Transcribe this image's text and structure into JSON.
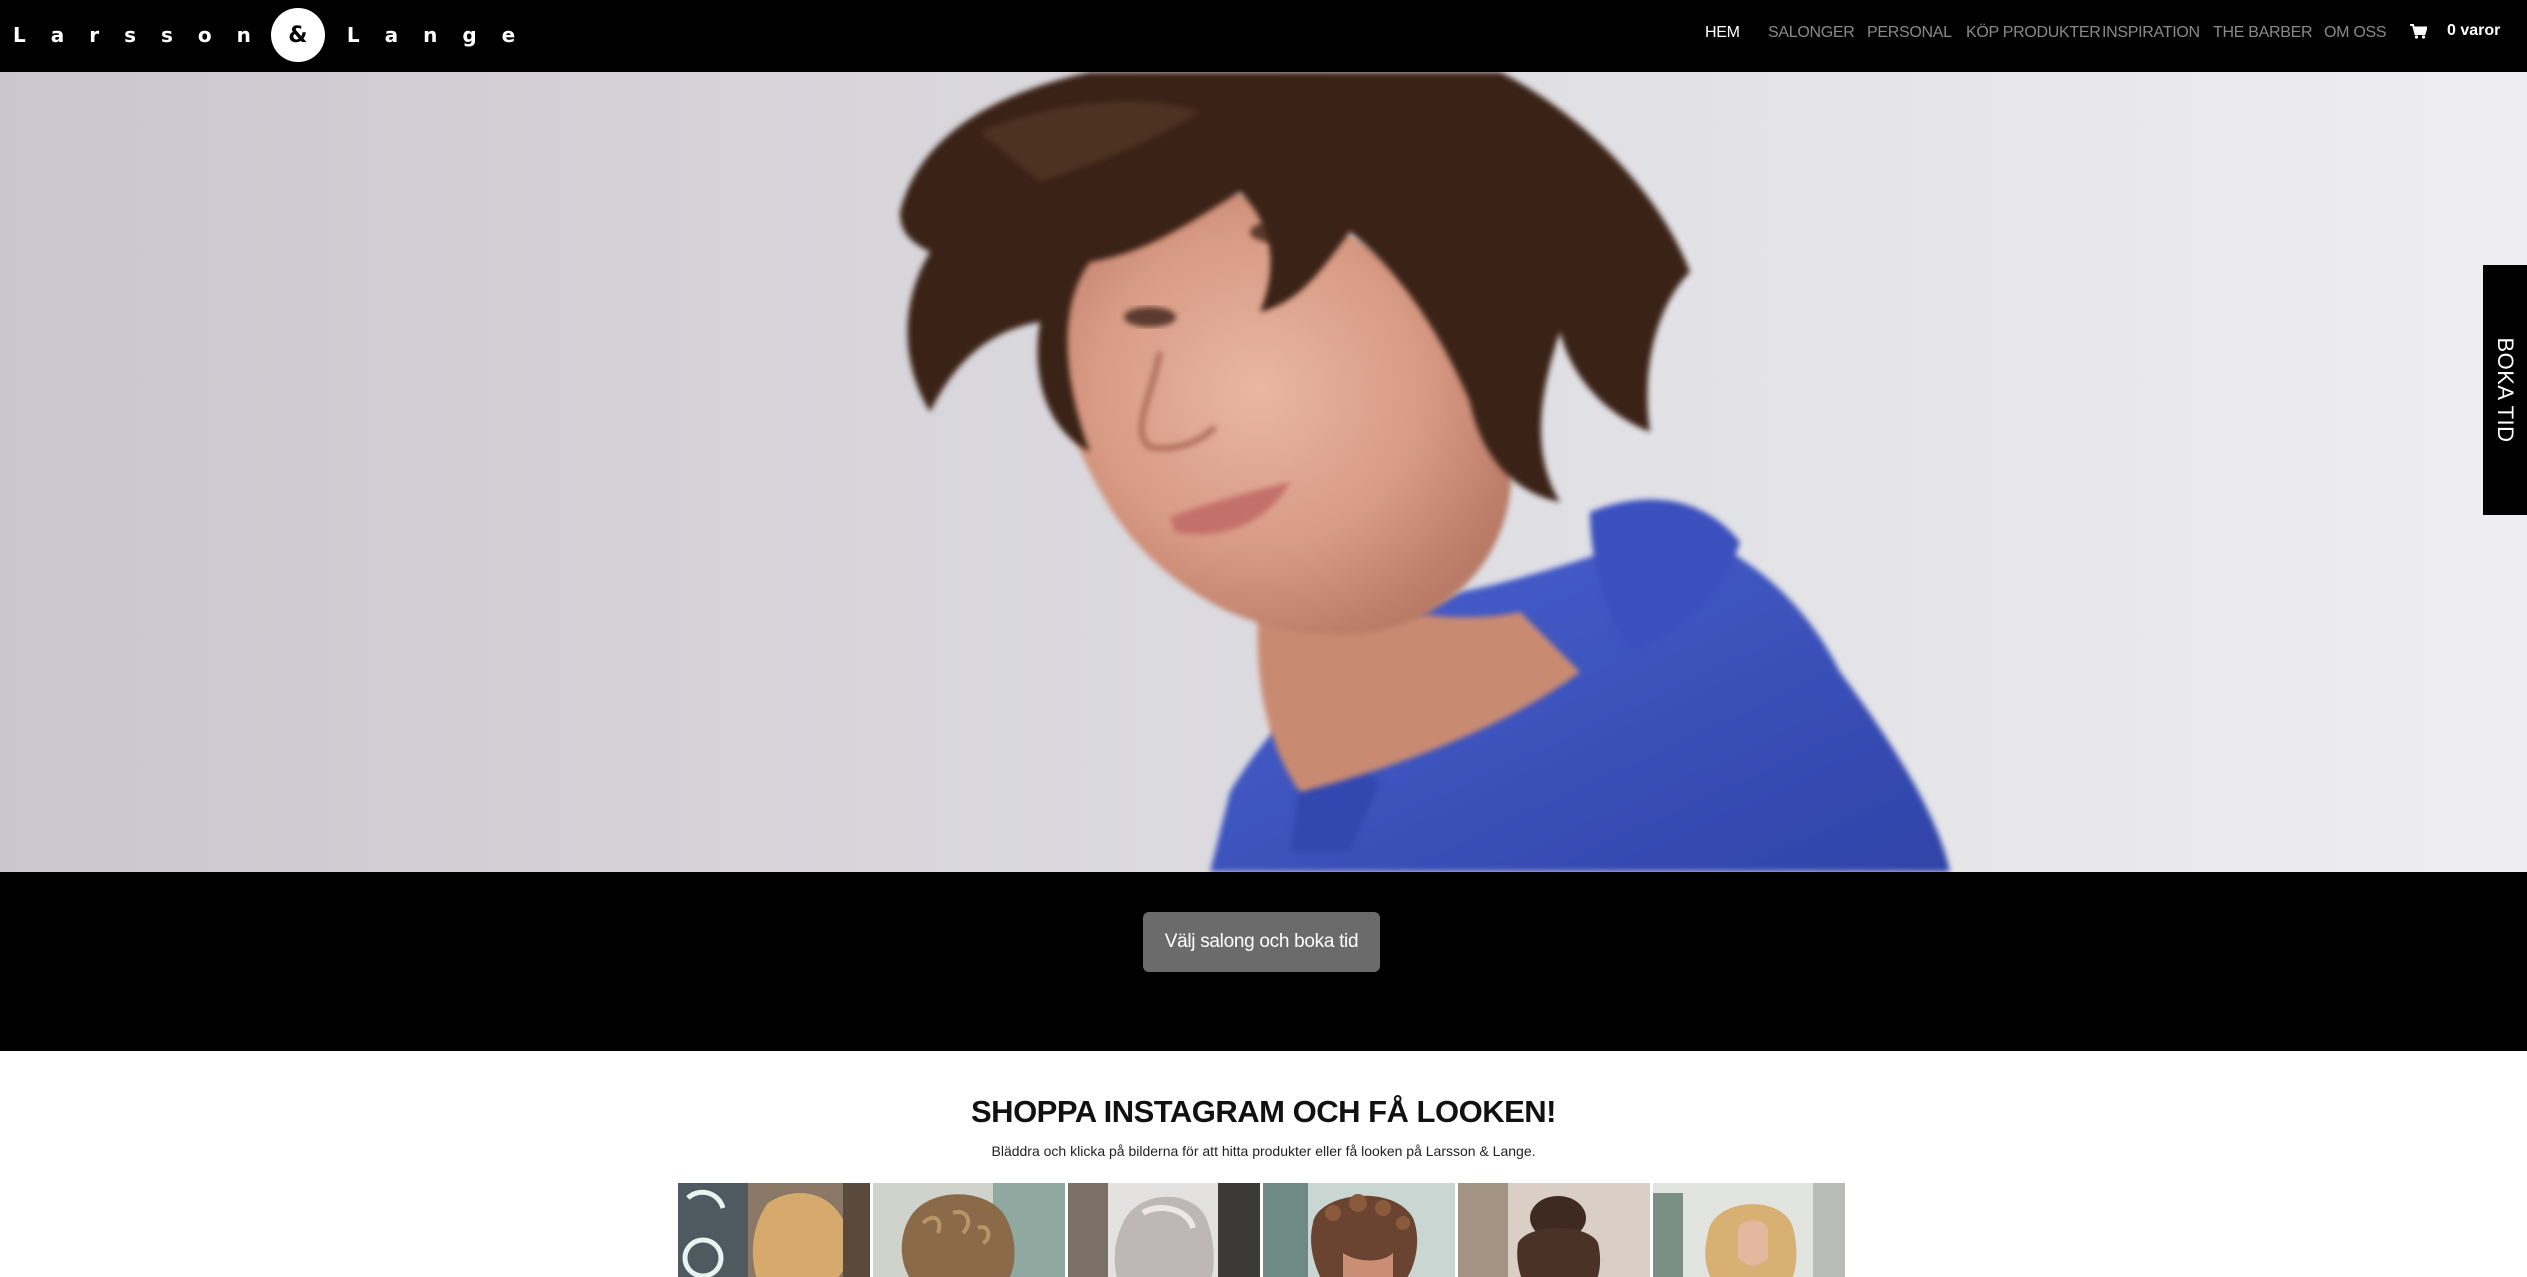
{
  "brand": {
    "logo_left": "Larsson",
    "logo_amp": "&",
    "logo_right": "Lange"
  },
  "nav": {
    "items": [
      {
        "label": "HEM",
        "active": true
      },
      {
        "label": "SALONGER",
        "active": false
      },
      {
        "label": "PERSONAL",
        "active": false
      },
      {
        "label": "KÖP PRODUKTER",
        "active": false
      },
      {
        "label": "INSPIRATION",
        "active": false
      },
      {
        "label": "THE BARBER",
        "active": false
      },
      {
        "label": "OM OSS",
        "active": false
      }
    ],
    "cart_label": "0 varor",
    "cart_icon": "cart-icon"
  },
  "side_tab": {
    "label": "BOKA TID"
  },
  "hero": {
    "image_icon": "hero-portrait-image"
  },
  "booking": {
    "button_label": "Välj salong och boka tid"
  },
  "instagram": {
    "title": "SHOPPA INSTAGRAM OCH FÅ LOOKEN!",
    "subtitle": "Bläddra och klicka på bilderna för att hitta produkter eller få looken på Larsson & Lange."
  },
  "colors": {
    "nav_bg": "#000000",
    "nav_active": "#ffffff",
    "nav_inactive": "#8a8a8a",
    "button_bg": "#6b6b6b",
    "shirt_blue": "#3f57c4"
  }
}
